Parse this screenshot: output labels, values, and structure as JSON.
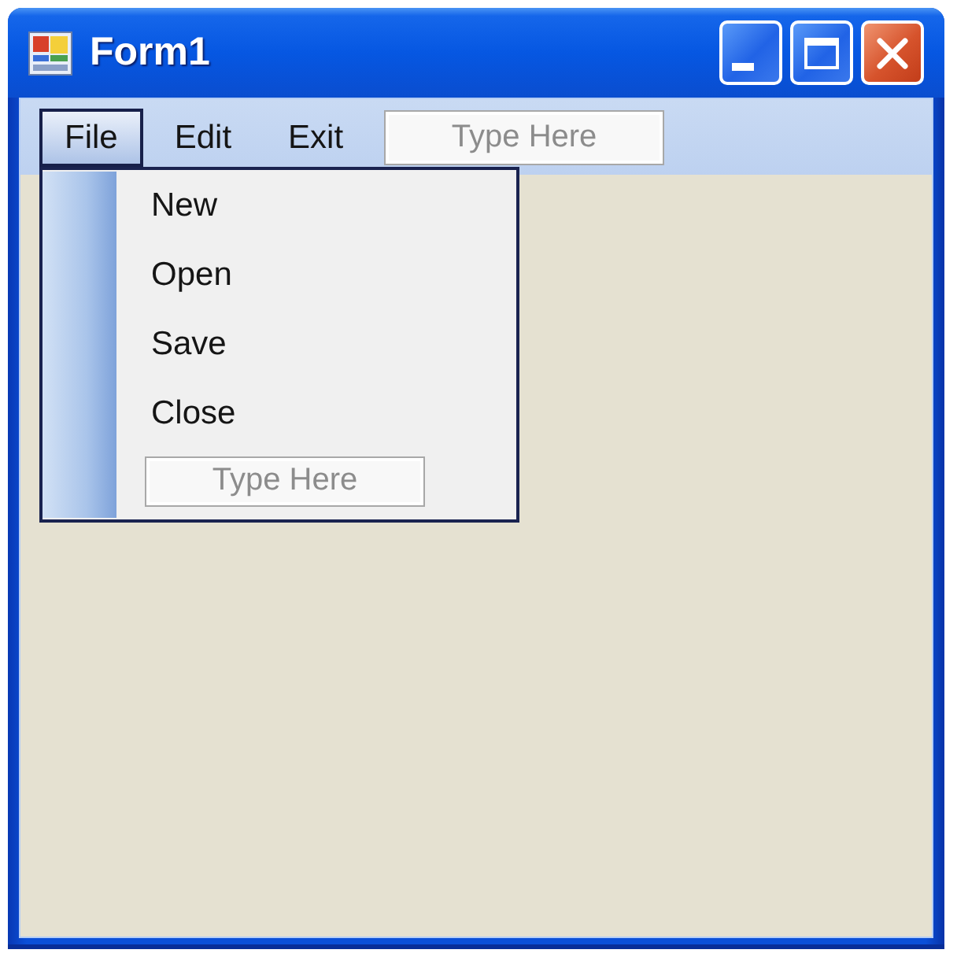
{
  "window": {
    "title": "Form1"
  },
  "menu_bar": {
    "items": [
      {
        "label": "File",
        "selected": true,
        "submenu": {
          "items": [
            "New",
            "Open",
            "Save",
            "Close"
          ],
          "placeholder": "Type Here"
        }
      },
      {
        "label": "Edit",
        "selected": false
      },
      {
        "label": "Exit",
        "selected": false
      }
    ],
    "placeholder": "Type Here"
  }
}
